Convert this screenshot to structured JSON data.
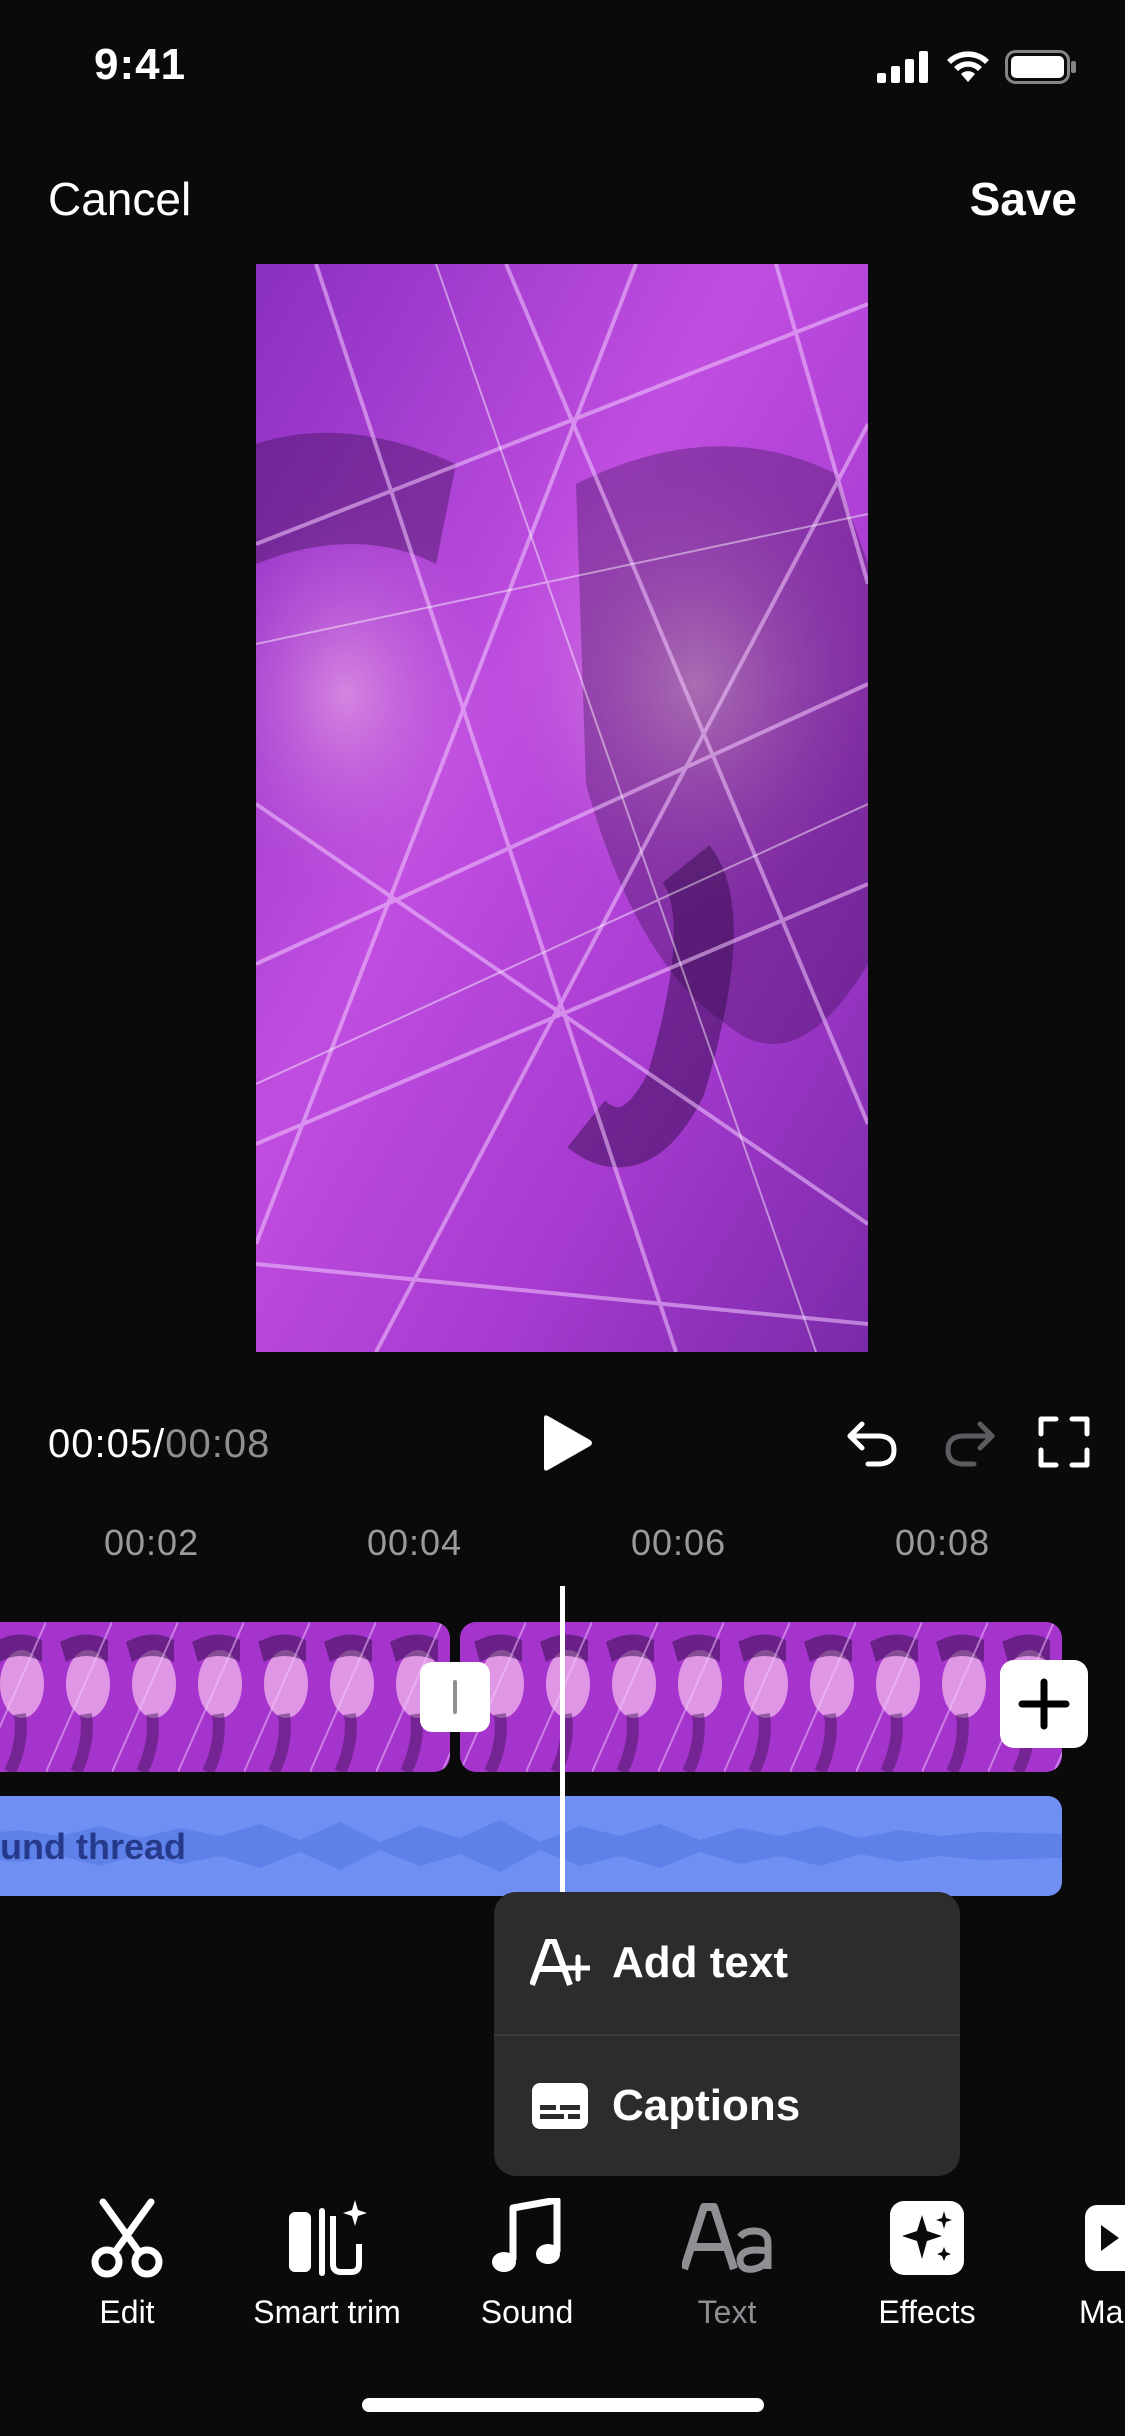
{
  "status_bar": {
    "time": "9:41"
  },
  "nav": {
    "cancel": "Cancel",
    "save": "Save"
  },
  "playback": {
    "current": "00:05",
    "separator": "/",
    "total": "00:08"
  },
  "ruler": [
    "00:02",
    "00:04",
    "00:06",
    "00:08"
  ],
  "audio": {
    "label": "und thread"
  },
  "popover": {
    "items": [
      {
        "label": "Add text",
        "icon": "add-text-icon"
      },
      {
        "label": "Captions",
        "icon": "captions-icon"
      }
    ]
  },
  "toolbar": {
    "items": [
      {
        "label": "Edit",
        "icon": "scissors-icon",
        "active": true
      },
      {
        "label": "Smart trim",
        "icon": "smart-trim-icon",
        "active": true
      },
      {
        "label": "Sound",
        "icon": "music-note-icon",
        "active": true
      },
      {
        "label": "Text",
        "icon": "text-aa-icon",
        "active": false
      },
      {
        "label": "Effects",
        "icon": "sparkles-icon",
        "active": true
      },
      {
        "label": "Ma",
        "icon": "media-icon",
        "active": true
      }
    ]
  },
  "colors": {
    "background": "#0a0a0b",
    "audio_track": "#6f8ff3",
    "popover": "#2c2c2e",
    "clip_purple": "#b23cd6"
  }
}
